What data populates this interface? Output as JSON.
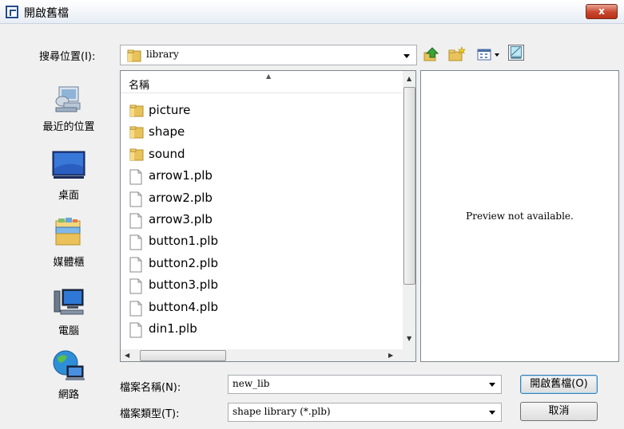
{
  "window": {
    "title": "開啟舊檔",
    "close_label": "x"
  },
  "lookin": {
    "label": "搜尋位置(I):",
    "value": "library"
  },
  "toolbar": {
    "icons": [
      "up-one-level-icon",
      "new-folder-icon",
      "view-menu-icon",
      "preview-toggle-icon"
    ]
  },
  "places": [
    {
      "label": "最近的位置",
      "icon": "recent-places-icon"
    },
    {
      "label": "桌面",
      "icon": "desktop-icon"
    },
    {
      "label": "媒體櫃",
      "icon": "libraries-icon"
    },
    {
      "label": "電腦",
      "icon": "computer-icon"
    },
    {
      "label": "網路",
      "icon": "network-icon"
    }
  ],
  "filelist": {
    "column_header": "名稱",
    "items": [
      {
        "name": "picture",
        "type": "folder"
      },
      {
        "name": "shape",
        "type": "folder"
      },
      {
        "name": "sound",
        "type": "folder"
      },
      {
        "name": "arrow1.plb",
        "type": "file"
      },
      {
        "name": "arrow2.plb",
        "type": "file"
      },
      {
        "name": "arrow3.plb",
        "type": "file"
      },
      {
        "name": "button1.plb",
        "type": "file"
      },
      {
        "name": "button2.plb",
        "type": "file"
      },
      {
        "name": "button3.plb",
        "type": "file"
      },
      {
        "name": "button4.plb",
        "type": "file"
      },
      {
        "name": "din1.plb",
        "type": "file"
      }
    ]
  },
  "preview": {
    "message": "Preview not available."
  },
  "filename": {
    "label": "檔案名稱(N):",
    "value": "new_lib"
  },
  "filetype": {
    "label": "檔案類型(T):",
    "value": "shape library (*.plb)"
  },
  "buttons": {
    "open": "開啟舊檔(O)",
    "cancel": "取消"
  }
}
